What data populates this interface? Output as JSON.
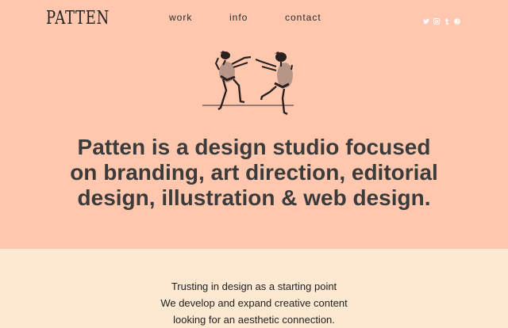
{
  "header": {
    "logo": "PATTEN",
    "nav": [
      {
        "label": "work"
      },
      {
        "label": "info"
      },
      {
        "label": "contact"
      }
    ],
    "social_icons": [
      "twitter-icon",
      "instagram-icon",
      "tumblr-icon",
      "pinterest-icon"
    ]
  },
  "hero": {
    "headline_lines": [
      "Patten is a design studio focused",
      "on branding, art direction, editorial",
      "design, illustration & web design."
    ]
  },
  "intro": {
    "lines": [
      "Trusting in design as a starting point",
      "We develop and expand creative content",
      "looking for an aesthetic connection."
    ]
  },
  "colors": {
    "hero_bg": "#ffc8ae",
    "section_bg": "#fde9d2",
    "text": "#3b3b3b"
  }
}
